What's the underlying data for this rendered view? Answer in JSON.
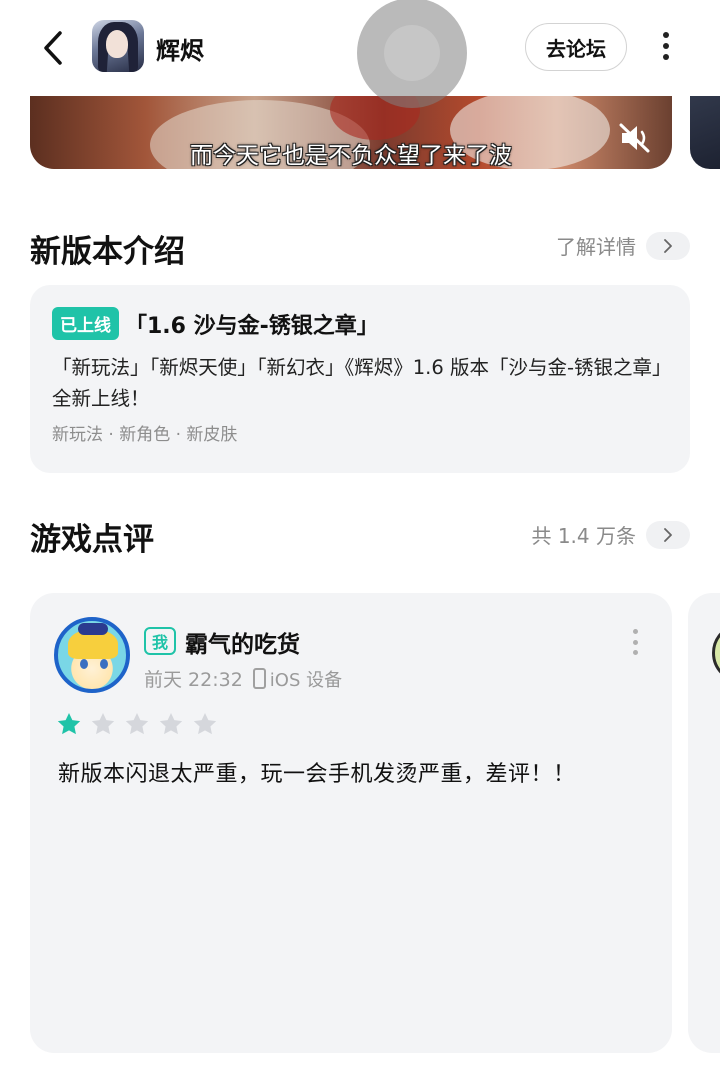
{
  "header": {
    "app_name": "辉烬",
    "forum_button": "去论坛"
  },
  "video": {
    "subtitle": "而今天它也是不负众望了来了波"
  },
  "new_version": {
    "title": "新版本介绍",
    "more_label": "了解详情",
    "badge": "已上线",
    "headline": "「1.6 沙与金-锈银之章」",
    "description": "「新玩法」「新烬天使」「新幻衣」《辉烬》1.6 版本「沙与金-锈银之章」全新上线！",
    "tags": "新玩法 · 新角色 · 新皮肤"
  },
  "reviews": {
    "title": "游戏点评",
    "count_label": "共 1.4 万条",
    "items": [
      {
        "me_badge": "我",
        "user": "霸气的吃货",
        "time": "前天 22:32",
        "device": "iOS 设备",
        "rating": 1,
        "max_rating": 5,
        "text": "新版本闪退太严重，玩一会手机发烫严重，差评！！"
      }
    ]
  },
  "colors": {
    "accent": "#1fc3a8",
    "card_bg": "#f3f4f6",
    "star_empty": "#d5d7dc"
  }
}
